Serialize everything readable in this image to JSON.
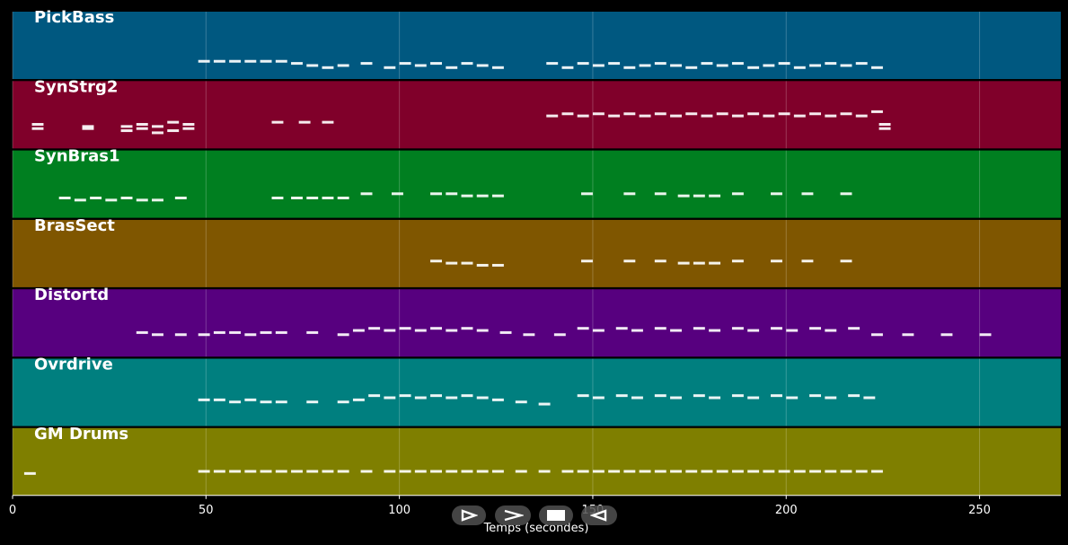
{
  "chart_data": {
    "type": "piano-roll",
    "xlabel": "Temps (secondes)",
    "xlim": [
      0,
      271
    ],
    "xticks": [
      0,
      50,
      100,
      150,
      200,
      250
    ],
    "grid": true,
    "tracks": [
      {
        "name": "PickBass",
        "color": "#005880",
        "pitch_range": [
          0,
          20
        ],
        "notes": [
          [
            48,
            5
          ],
          [
            52,
            5
          ],
          [
            56,
            5
          ],
          [
            60,
            5
          ],
          [
            64,
            5
          ],
          [
            68,
            5
          ],
          [
            72,
            4
          ],
          [
            76,
            3
          ],
          [
            80,
            2
          ],
          [
            84,
            3
          ],
          [
            90,
            4
          ],
          [
            96,
            2
          ],
          [
            100,
            4
          ],
          [
            104,
            3
          ],
          [
            108,
            4
          ],
          [
            112,
            2
          ],
          [
            116,
            4
          ],
          [
            120,
            3
          ],
          [
            124,
            2
          ],
          [
            138,
            4
          ],
          [
            142,
            2
          ],
          [
            146,
            4
          ],
          [
            150,
            3
          ],
          [
            154,
            4
          ],
          [
            158,
            2
          ],
          [
            162,
            3
          ],
          [
            166,
            4
          ],
          [
            170,
            3
          ],
          [
            174,
            2
          ],
          [
            178,
            4
          ],
          [
            182,
            3
          ],
          [
            186,
            4
          ],
          [
            190,
            2
          ],
          [
            194,
            3
          ],
          [
            198,
            4
          ],
          [
            202,
            2
          ],
          [
            206,
            3
          ],
          [
            210,
            4
          ],
          [
            214,
            3
          ],
          [
            218,
            4
          ],
          [
            222,
            2
          ]
        ]
      },
      {
        "name": "SynStrg2",
        "color": "#80002a",
        "pitch_range": [
          0,
          20
        ],
        "notes": [
          [
            5,
            6
          ],
          [
            5,
            8
          ],
          [
            18,
            6
          ],
          [
            18,
            7
          ],
          [
            28,
            7
          ],
          [
            28,
            5
          ],
          [
            32,
            8
          ],
          [
            32,
            6
          ],
          [
            36,
            7
          ],
          [
            36,
            4
          ],
          [
            40,
            9
          ],
          [
            40,
            5
          ],
          [
            44,
            8
          ],
          [
            44,
            6
          ],
          [
            67,
            9
          ],
          [
            74,
            9
          ],
          [
            80,
            9
          ],
          [
            138,
            12
          ],
          [
            142,
            13
          ],
          [
            146,
            12
          ],
          [
            150,
            13
          ],
          [
            154,
            12
          ],
          [
            158,
            13
          ],
          [
            162,
            12
          ],
          [
            166,
            13
          ],
          [
            170,
            12
          ],
          [
            174,
            13
          ],
          [
            178,
            12
          ],
          [
            182,
            13
          ],
          [
            186,
            12
          ],
          [
            190,
            13
          ],
          [
            194,
            12
          ],
          [
            198,
            13
          ],
          [
            202,
            12
          ],
          [
            206,
            13
          ],
          [
            210,
            12
          ],
          [
            214,
            13
          ],
          [
            218,
            12
          ],
          [
            222,
            14
          ],
          [
            224,
            8
          ],
          [
            224,
            6
          ]
        ]
      },
      {
        "name": "SynBras1",
        "color": "#007f20",
        "pitch_range": [
          0,
          20
        ],
        "notes": [
          [
            12,
            6
          ],
          [
            16,
            5
          ],
          [
            20,
            6
          ],
          [
            24,
            5
          ],
          [
            28,
            6
          ],
          [
            32,
            5
          ],
          [
            36,
            5
          ],
          [
            42,
            6
          ],
          [
            67,
            6
          ],
          [
            72,
            6
          ],
          [
            76,
            6
          ],
          [
            80,
            6
          ],
          [
            84,
            6
          ],
          [
            90,
            8
          ],
          [
            98,
            8
          ],
          [
            108,
            8
          ],
          [
            112,
            8
          ],
          [
            116,
            7
          ],
          [
            120,
            7
          ],
          [
            124,
            7
          ],
          [
            147,
            8
          ],
          [
            158,
            8
          ],
          [
            166,
            8
          ],
          [
            172,
            7
          ],
          [
            176,
            7
          ],
          [
            180,
            7
          ],
          [
            186,
            8
          ],
          [
            196,
            8
          ],
          [
            204,
            8
          ],
          [
            214,
            8
          ]
        ]
      },
      {
        "name": "BrasSect",
        "color": "#7f5600",
        "pitch_range": [
          0,
          20
        ],
        "notes": [
          [
            108,
            9
          ],
          [
            112,
            8
          ],
          [
            116,
            8
          ],
          [
            120,
            7
          ],
          [
            124,
            7
          ],
          [
            147,
            9
          ],
          [
            158,
            9
          ],
          [
            166,
            9
          ],
          [
            172,
            8
          ],
          [
            176,
            8
          ],
          [
            180,
            8
          ],
          [
            186,
            9
          ],
          [
            196,
            9
          ],
          [
            204,
            9
          ],
          [
            214,
            9
          ]
        ]
      },
      {
        "name": "Distortd",
        "color": "#57007f",
        "pitch_range": [
          0,
          20
        ],
        "notes": [
          [
            32,
            8
          ],
          [
            36,
            7
          ],
          [
            42,
            7
          ],
          [
            48,
            7
          ],
          [
            52,
            8
          ],
          [
            56,
            8
          ],
          [
            60,
            7
          ],
          [
            64,
            8
          ],
          [
            68,
            8
          ],
          [
            76,
            8
          ],
          [
            84,
            7
          ],
          [
            88,
            9
          ],
          [
            92,
            10
          ],
          [
            96,
            9
          ],
          [
            100,
            10
          ],
          [
            104,
            9
          ],
          [
            108,
            10
          ],
          [
            112,
            9
          ],
          [
            116,
            10
          ],
          [
            120,
            9
          ],
          [
            126,
            8
          ],
          [
            132,
            7
          ],
          [
            140,
            7
          ],
          [
            146,
            10
          ],
          [
            150,
            9
          ],
          [
            156,
            10
          ],
          [
            160,
            9
          ],
          [
            166,
            10
          ],
          [
            170,
            9
          ],
          [
            176,
            10
          ],
          [
            180,
            9
          ],
          [
            186,
            10
          ],
          [
            190,
            9
          ],
          [
            196,
            10
          ],
          [
            200,
            9
          ],
          [
            206,
            10
          ],
          [
            210,
            9
          ],
          [
            216,
            10
          ],
          [
            222,
            7
          ],
          [
            230,
            7
          ],
          [
            240,
            7
          ],
          [
            250,
            7
          ]
        ]
      },
      {
        "name": "Ovrdrive",
        "color": "#007f7f",
        "pitch_range": [
          0,
          20
        ],
        "notes": [
          [
            48,
            9
          ],
          [
            52,
            9
          ],
          [
            56,
            8
          ],
          [
            60,
            9
          ],
          [
            64,
            8
          ],
          [
            68,
            8
          ],
          [
            76,
            8
          ],
          [
            84,
            8
          ],
          [
            88,
            9
          ],
          [
            92,
            11
          ],
          [
            96,
            10
          ],
          [
            100,
            11
          ],
          [
            104,
            10
          ],
          [
            108,
            11
          ],
          [
            112,
            10
          ],
          [
            116,
            11
          ],
          [
            120,
            10
          ],
          [
            124,
            9
          ],
          [
            130,
            8
          ],
          [
            136,
            7
          ],
          [
            146,
            11
          ],
          [
            150,
            10
          ],
          [
            156,
            11
          ],
          [
            160,
            10
          ],
          [
            166,
            11
          ],
          [
            170,
            10
          ],
          [
            176,
            11
          ],
          [
            180,
            10
          ],
          [
            186,
            11
          ],
          [
            190,
            10
          ],
          [
            196,
            11
          ],
          [
            200,
            10
          ],
          [
            206,
            11
          ],
          [
            210,
            10
          ],
          [
            216,
            11
          ],
          [
            220,
            10
          ]
        ]
      },
      {
        "name": "GM Drums",
        "color": "#7f7f00",
        "pitch_range": [
          0,
          20
        ],
        "notes": [
          [
            3,
            7
          ],
          [
            48,
            8
          ],
          [
            52,
            8
          ],
          [
            56,
            8
          ],
          [
            60,
            8
          ],
          [
            64,
            8
          ],
          [
            68,
            8
          ],
          [
            72,
            8
          ],
          [
            76,
            8
          ],
          [
            80,
            8
          ],
          [
            84,
            8
          ],
          [
            90,
            8
          ],
          [
            96,
            8
          ],
          [
            100,
            8
          ],
          [
            104,
            8
          ],
          [
            108,
            8
          ],
          [
            112,
            8
          ],
          [
            116,
            8
          ],
          [
            120,
            8
          ],
          [
            124,
            8
          ],
          [
            130,
            8
          ],
          [
            136,
            8
          ],
          [
            142,
            8
          ],
          [
            146,
            8
          ],
          [
            150,
            8
          ],
          [
            154,
            8
          ],
          [
            158,
            8
          ],
          [
            162,
            8
          ],
          [
            166,
            8
          ],
          [
            170,
            8
          ],
          [
            174,
            8
          ],
          [
            178,
            8
          ],
          [
            182,
            8
          ],
          [
            186,
            8
          ],
          [
            190,
            8
          ],
          [
            194,
            8
          ],
          [
            198,
            8
          ],
          [
            202,
            8
          ],
          [
            206,
            8
          ],
          [
            210,
            8
          ],
          [
            214,
            8
          ],
          [
            218,
            8
          ],
          [
            222,
            8
          ]
        ]
      }
    ]
  },
  "controls": {
    "play_label": "play",
    "fast_forward_label": "fast-forward",
    "stop_label": "stop",
    "rewind_label": "rewind"
  }
}
